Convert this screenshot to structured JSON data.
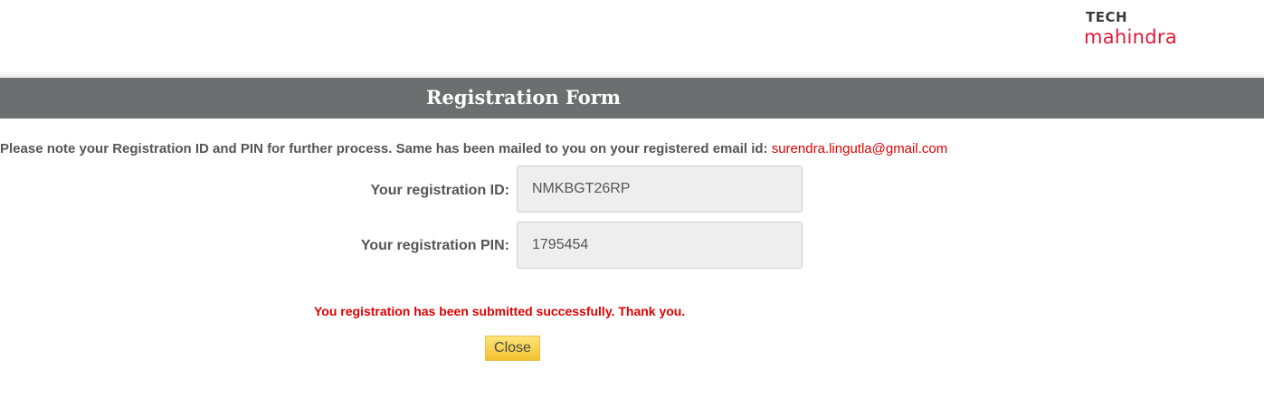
{
  "header": {
    "logo_line1": "TECH",
    "logo_line2": "mahindra",
    "logo_color_primary": "#3a3a3a",
    "logo_color_accent": "#e31837"
  },
  "title_bar": {
    "title": "Registration Form",
    "background": "#6d6e70"
  },
  "notice": {
    "text": "Please note your Registration ID and PIN for further process. Same has been mailed to you on your registered email id: ",
    "email": "surendra.lingutla@gmail.com",
    "email_color": "#e00000"
  },
  "fields": [
    {
      "label": "Your registration ID:",
      "value": "NMKBGT26RP"
    },
    {
      "label": "Your registration PIN:",
      "value": "1795454"
    }
  ],
  "status": {
    "message": "You registration has been submitted successfully. Thank you.",
    "color": "#e00000"
  },
  "actions": {
    "close_label": "Close"
  }
}
